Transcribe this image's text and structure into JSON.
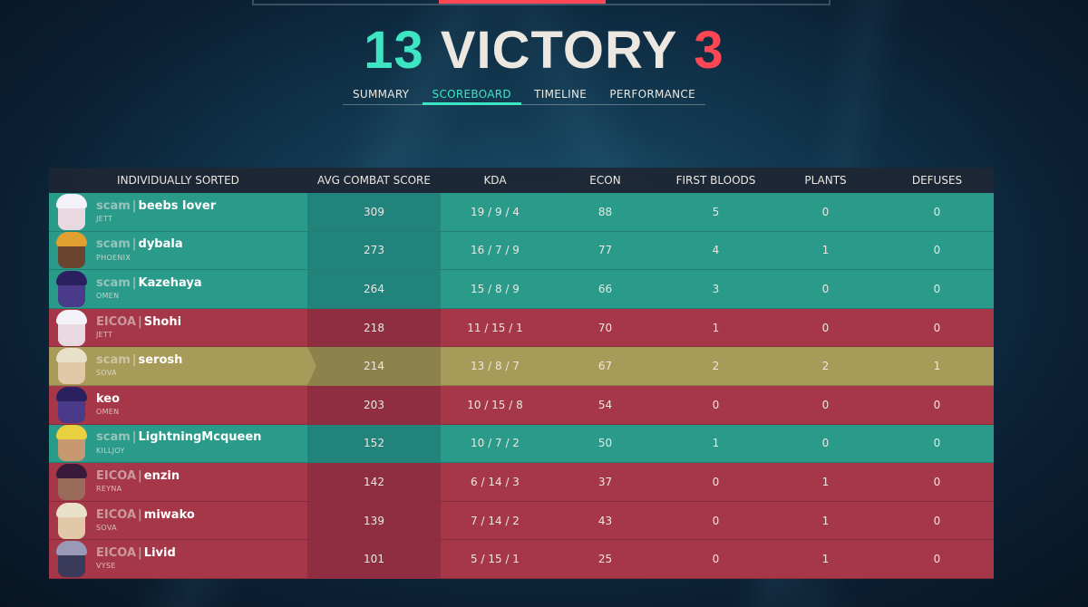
{
  "header": {
    "team_score": "13",
    "result": "VICTORY",
    "enemy_score": "3"
  },
  "tabs": [
    {
      "label": "SUMMARY",
      "active": false
    },
    {
      "label": "SCOREBOARD",
      "active": true
    },
    {
      "label": "TIMELINE",
      "active": false
    },
    {
      "label": "PERFORMANCE",
      "active": false
    }
  ],
  "columns": {
    "name": "INDIVIDUALLY SORTED",
    "acs": "AVG COMBAT SCORE",
    "kda": "KDA",
    "econ": "ECON",
    "first_bloods": "FIRST BLOODS",
    "plants": "PLANTS",
    "defuses": "DEFUSES"
  },
  "colors": {
    "team_a": "#2a9a8a",
    "team_b": "#a53748",
    "self": "#a89a58",
    "accent": "#3ee5c2",
    "red": "#ff4655"
  },
  "players": [
    {
      "tag": "scam",
      "name": "beebs lover",
      "agent": "JETT",
      "acs": "309",
      "kda": "19 / 9 / 4",
      "econ": "88",
      "fb": "5",
      "plants": "0",
      "defuses": "0",
      "team": "team-a",
      "skin": "#e8d8e0",
      "hair": "#f2f2f8"
    },
    {
      "tag": "scam",
      "name": "dybala",
      "agent": "PHOENIX",
      "acs": "273",
      "kda": "16 / 7 / 9",
      "econ": "77",
      "fb": "4",
      "plants": "1",
      "defuses": "0",
      "team": "team-a",
      "skin": "#6b4530",
      "hair": "#e0a030"
    },
    {
      "tag": "scam",
      "name": "Kazehaya",
      "agent": "OMEN",
      "acs": "264",
      "kda": "15 / 8 / 9",
      "econ": "66",
      "fb": "3",
      "plants": "0",
      "defuses": "0",
      "team": "team-a",
      "skin": "#4a3a8a",
      "hair": "#2a2060"
    },
    {
      "tag": "EICOA",
      "name": "Shohi",
      "agent": "JETT",
      "acs": "218",
      "kda": "11 / 15 / 1",
      "econ": "70",
      "fb": "1",
      "plants": "0",
      "defuses": "0",
      "team": "team-b",
      "skin": "#e8d8e0",
      "hair": "#f2f2f8"
    },
    {
      "tag": "scam",
      "name": "serosh",
      "agent": "SOVA",
      "acs": "214",
      "kda": "13 / 8 / 7",
      "econ": "67",
      "fb": "2",
      "plants": "2",
      "defuses": "1",
      "team": "self",
      "skin": "#e0c8a8",
      "hair": "#e8e0c8"
    },
    {
      "tag": "",
      "name": "keo",
      "agent": "OMEN",
      "acs": "203",
      "kda": "10 / 15 / 8",
      "econ": "54",
      "fb": "0",
      "plants": "0",
      "defuses": "0",
      "team": "team-b",
      "skin": "#4a3a8a",
      "hair": "#2a2060"
    },
    {
      "tag": "scam",
      "name": "LightningMcqueen",
      "agent": "KILLJOY",
      "acs": "152",
      "kda": "10 / 7 / 2",
      "econ": "50",
      "fb": "1",
      "plants": "0",
      "defuses": "0",
      "team": "team-a",
      "skin": "#c89870",
      "hair": "#e8d040"
    },
    {
      "tag": "EICOA",
      "name": "enzin",
      "agent": "REYNA",
      "acs": "142",
      "kda": "6 / 14 / 3",
      "econ": "37",
      "fb": "0",
      "plants": "1",
      "defuses": "0",
      "team": "team-b",
      "skin": "#9a6a5a",
      "hair": "#3a1a3a"
    },
    {
      "tag": "EICOA",
      "name": "miwako",
      "agent": "SOVA",
      "acs": "139",
      "kda": "7 / 14 / 2",
      "econ": "43",
      "fb": "0",
      "plants": "1",
      "defuses": "0",
      "team": "team-b",
      "skin": "#e0c8a8",
      "hair": "#e8e0c8"
    },
    {
      "tag": "EICOA",
      "name": "Livid",
      "agent": "VYSE",
      "acs": "101",
      "kda": "5 / 15 / 1",
      "econ": "25",
      "fb": "0",
      "plants": "1",
      "defuses": "0",
      "team": "team-b",
      "skin": "#3a3a5a",
      "hair": "#9a9ab8"
    }
  ]
}
